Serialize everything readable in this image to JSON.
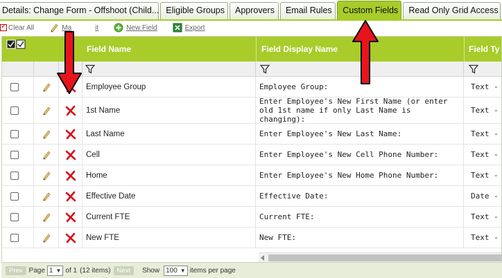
{
  "tabs": [
    {
      "label": "Details: Change Form - Offshoot (Child...",
      "active": false
    },
    {
      "label": "Eligible Groups",
      "active": false
    },
    {
      "label": "Approvers",
      "active": false
    },
    {
      "label": "Email Rules",
      "active": false
    },
    {
      "label": "Custom Fields",
      "active": true
    },
    {
      "label": "Read Only Grid Access",
      "active": false
    }
  ],
  "toolbar": {
    "clear_all": "Clear All",
    "mass_edit": "Mass Edit",
    "mass_edit_visible": "Ma",
    "mass_edit_tail": "it",
    "new_field": "New Field",
    "export": "Export"
  },
  "grid": {
    "columns": {
      "field_name": "Field Name",
      "field_display_name": "Field Display Name",
      "field_type": "Field Ty"
    },
    "rows": [
      {
        "name": "Employee Group",
        "display": "Employee Group:",
        "type": "Text - Sl"
      },
      {
        "name": "1st Name",
        "display": "Enter Employee's New First Name (or enter old 1st name if only Last Name is changing):",
        "type": "Text - Sl"
      },
      {
        "name": "Last Name",
        "display": "Enter Employee's New Last Name:",
        "type": "Text - Sl"
      },
      {
        "name": "Cell",
        "display": "Enter Employee's New Cell Phone Number:",
        "type": "Text - Sl"
      },
      {
        "name": "Home",
        "display": "Enter Employee's New Home Phone Number:",
        "type": "Text - Sl"
      },
      {
        "name": "Effective Date",
        "display": "Effective Date:",
        "type": "Date - S"
      },
      {
        "name": "Current FTE",
        "display": "Current FTE:",
        "type": "Text - Sl"
      },
      {
        "name": "New FTE",
        "display": "New FTE:",
        "type": "Text - Sl"
      }
    ]
  },
  "pager": {
    "prev": "Prev",
    "page_label": "Page",
    "page_value": "1",
    "of_text": "of 1",
    "items_text": "(12 items)",
    "next": "Next",
    "show_label": "Show",
    "show_value": "100",
    "per_page": "items per page"
  },
  "colors": {
    "accent": "#a8cc2a",
    "annotation": "#e8141c"
  }
}
